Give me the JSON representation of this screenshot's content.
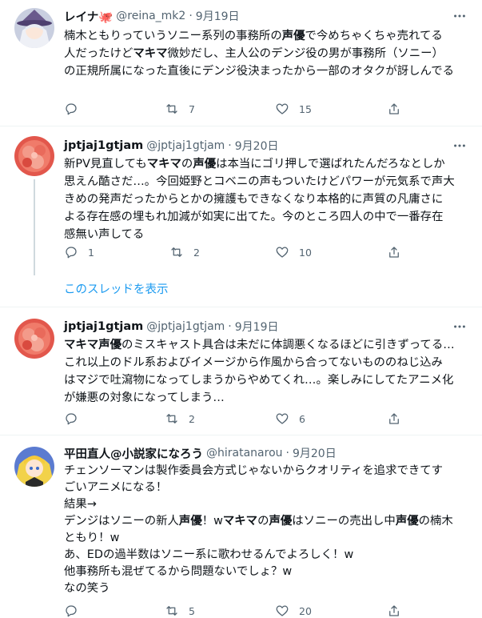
{
  "tweets": [
    {
      "name": "レイナ🐙",
      "handle": "@reina_mk2",
      "sep": "·",
      "date": "9月19日",
      "lines": [
        [
          {
            "t": "楠木ともりっていうソニー系列の事務所の",
            "b": false
          },
          {
            "t": "声優",
            "b": true
          },
          {
            "t": "で今めちゃくちゃ売れてる",
            "b": false
          }
        ],
        [
          {
            "t": "人だったけど",
            "b": false
          },
          {
            "t": "マキマ",
            "b": true
          },
          {
            "t": "微妙だし、主人公のデンジ役の男が事務所（ソニー）",
            "b": false
          }
        ],
        [
          {
            "t": "の正規所属になった直後にデンジ役決まったから一部のオタクが訝しんでる",
            "b": false
          }
        ]
      ],
      "reply_count": "",
      "retweet_count": "7",
      "like_count": "15"
    },
    {
      "name": "jptjaj1gtjam",
      "handle": "@jptjaj1gtjam",
      "sep": "·",
      "date": "9月20日",
      "lines": [
        [
          {
            "t": "新PV見直しても",
            "b": false
          },
          {
            "t": "マキマ",
            "b": true
          },
          {
            "t": "の",
            "b": false
          },
          {
            "t": "声優",
            "b": true
          },
          {
            "t": "は本当にゴリ押しで選ばれたんだろなとしか",
            "b": false
          }
        ],
        [
          {
            "t": "思えん酷さだ…。今回姫野とコベニの声もついたけどパワーが元気系で声大",
            "b": false
          }
        ],
        [
          {
            "t": "きめの発声だったからとかの擁護もできなくなり本格的に声質の凡庸さに",
            "b": false
          }
        ],
        [
          {
            "t": "よる存在感の埋もれ加減が如実に出てた。今のところ四人の中で一番存在",
            "b": false
          }
        ],
        [
          {
            "t": "感無い声してる",
            "b": false
          }
        ]
      ],
      "reply_count": "1",
      "retweet_count": "2",
      "like_count": "10"
    },
    {
      "name": "jptjaj1gtjam",
      "handle": "@jptjaj1gtjam",
      "sep": "·",
      "date": "9月19日",
      "lines": [
        [
          {
            "t": "マキマ",
            "b": true
          },
          {
            "t": "声優",
            "b": true
          },
          {
            "t": "のミスキャスト具合は未だに体調悪くなるほどに引きずってる…",
            "b": false
          }
        ],
        [
          {
            "t": "これ以上のドル系およびイメージから作風から合ってないもののねじ込み",
            "b": false
          }
        ],
        [
          {
            "t": "はマジで吐瀉物になってしまうからやめてくれ…。楽しみにしてたアニメ化",
            "b": false
          }
        ],
        [
          {
            "t": "が嫌悪の対象になってしまう…",
            "b": false
          }
        ]
      ],
      "reply_count": "",
      "retweet_count": "2",
      "like_count": "6"
    },
    {
      "name": "平田直人@小説家になろう",
      "handle": "@hiratanarou",
      "sep": "·",
      "date": "9月20日",
      "lines": [
        [
          {
            "t": "チェンソーマンは製作委員会方式じゃないからクオリティを追求できてす",
            "b": false
          }
        ],
        [
          {
            "t": "ごいアニメになる！",
            "b": false
          }
        ],
        [
          {
            "t": "結果→",
            "b": false
          }
        ],
        [
          {
            "t": "デンジはソニーの新人",
            "b": false
          },
          {
            "t": "声優",
            "b": true
          },
          {
            "t": "！w",
            "b": false
          },
          {
            "t": "マキマ",
            "b": true
          },
          {
            "t": "の",
            "b": false
          },
          {
            "t": "声優",
            "b": true
          },
          {
            "t": "はソニーの売出し中",
            "b": false
          },
          {
            "t": "声優",
            "b": true
          },
          {
            "t": "の楠木",
            "b": false
          }
        ],
        [
          {
            "t": "ともり！w",
            "b": false
          }
        ],
        [
          {
            "t": "あ、EDの過半数はソニー系に歌わせるんでよろしく！w",
            "b": false
          }
        ],
        [
          {
            "t": "他事務所も混ぜてるから問題ないでしょ？w",
            "b": false
          }
        ],
        [
          {
            "t": "なの笑う",
            "b": false
          }
        ]
      ],
      "reply_count": "",
      "retweet_count": "5",
      "like_count": "20"
    }
  ],
  "thread_link": "このスレッドを表示",
  "icons": {
    "reply": "reply-icon",
    "retweet": "retweet-icon",
    "like": "heart-icon",
    "share": "share-icon",
    "more": "more-icon"
  },
  "colors": {
    "text": "#0f1419",
    "secondary": "#536471",
    "link": "#1d9bf0",
    "divider": "#eff3f4"
  }
}
